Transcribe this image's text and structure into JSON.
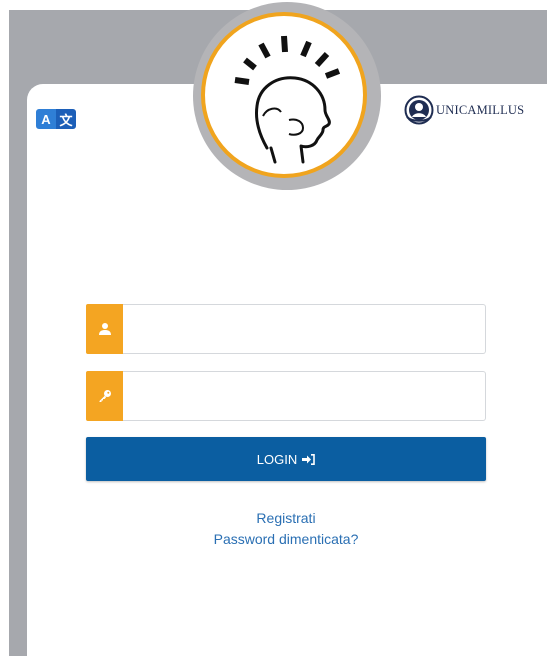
{
  "language_switch": {
    "letter_a": "A",
    "letter_b": "文",
    "icon": "translate-icon"
  },
  "brand": {
    "name": "UNICAMILLUS",
    "icon": "university-seal-icon"
  },
  "login_form": {
    "username": {
      "value": "",
      "placeholder": "",
      "icon": "user-icon"
    },
    "password": {
      "value": "",
      "placeholder": "",
      "icon": "key-icon"
    },
    "submit_label": "LOGIN",
    "submit_icon": "sign-in-icon"
  },
  "links": {
    "register": "Registrati",
    "forgot_password": "Password dimenticata?"
  },
  "colors": {
    "accent_orange": "#f4a522",
    "primary_blue": "#0b5ea1",
    "link_blue": "#2a6fb3",
    "backdrop_gray": "#a6a8ad"
  }
}
